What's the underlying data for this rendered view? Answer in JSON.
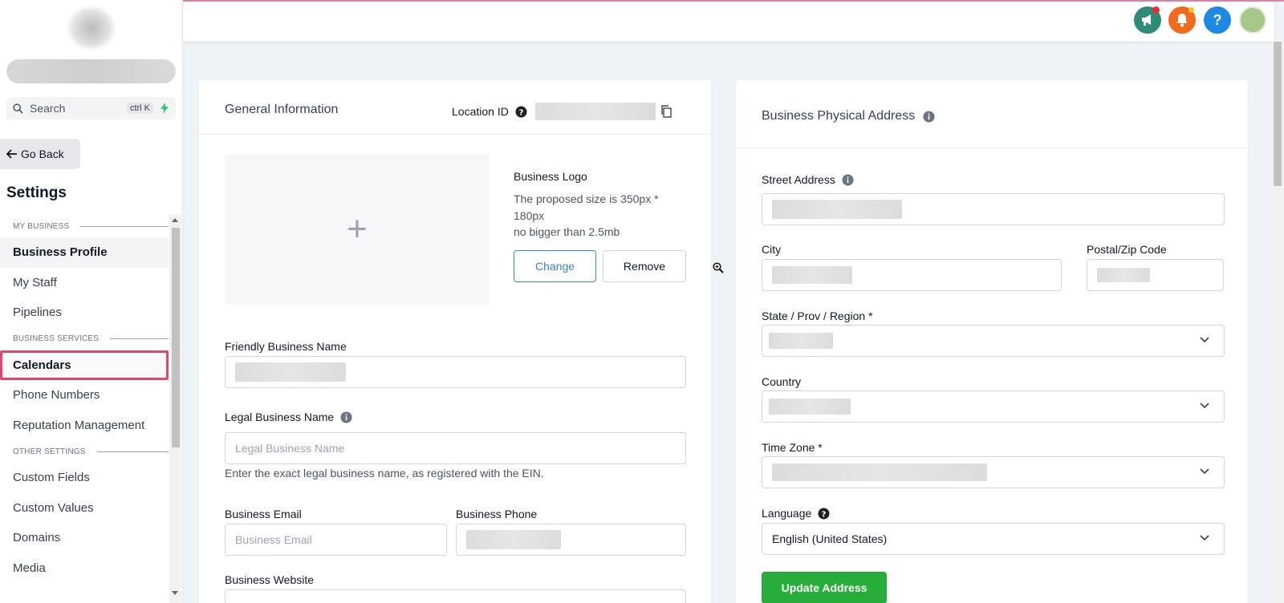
{
  "sidebar": {
    "search_label": "Search",
    "search_shortcut": "ctrl K",
    "go_back": "Go Back",
    "settings_title": "Settings",
    "sections": {
      "my_business": "MY BUSINESS",
      "business_services": "BUSINESS SERVICES",
      "other_settings": "OTHER SETTINGS"
    },
    "items": {
      "business_profile": "Business Profile",
      "my_staff": "My Staff",
      "pipelines": "Pipelines",
      "calendars": "Calendars",
      "phone_numbers": "Phone Numbers",
      "reputation_management": "Reputation Management",
      "custom_fields": "Custom Fields",
      "custom_values": "Custom Values",
      "domains": "Domains",
      "media": "Media"
    }
  },
  "header": {
    "icons": [
      "megaphone-icon",
      "bell-icon",
      "help-icon",
      "avatar"
    ],
    "help_glyph": "?"
  },
  "general": {
    "title": "General Information",
    "location_id_label": "Location ID",
    "logo_plus": "+",
    "logo_title": "Business Logo",
    "logo_size_hint": "The proposed size is 350px * 180px",
    "logo_weight_hint": "no bigger than 2.5mb",
    "change_button": "Change",
    "remove_button": "Remove",
    "friendly_name_label": "Friendly Business Name",
    "legal_name_label": "Legal Business Name",
    "legal_name_placeholder": "Legal Business Name",
    "legal_name_help": "Enter the exact legal business name, as registered with the EIN.",
    "email_label": "Business Email",
    "email_placeholder": "Business Email",
    "phone_label": "Business Phone",
    "website_label": "Business Website"
  },
  "address": {
    "title": "Business Physical Address",
    "street_label": "Street Address",
    "city_label": "City",
    "zip_label": "Postal/Zip Code",
    "state_label": "State / Prov / Region *",
    "country_label": "Country",
    "timezone_label": "Time Zone *",
    "language_label": "Language",
    "language_value": "English (United States)",
    "update_button": "Update Address"
  },
  "colors": {
    "accent": "#3b82c4",
    "update_green": "#27ae3a",
    "selected_outline": "#e0476a",
    "megaphone": "#2e8b77",
    "bell": "#f26a1b",
    "help": "#1e88e5"
  }
}
